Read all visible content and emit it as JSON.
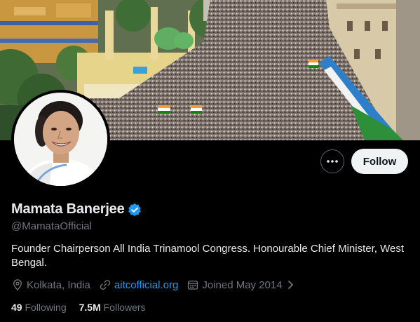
{
  "profile": {
    "display_name": "Mamata Banerjee",
    "handle": "@MamataOfficial",
    "bio": "Founder Chairperson All India Trinamool Congress. Honourable Chief Minister, West Bengal.",
    "verified_color": "#1d9bf0",
    "location": "Kolkata, India",
    "website": "aitcofficial.org",
    "joined": "Joined May 2014",
    "following_count": "49",
    "following_label": "Following",
    "followers_count": "7.5M",
    "followers_label": "Followers"
  },
  "actions": {
    "follow_label": "Follow",
    "more_icon": "more-horizontal-icon"
  },
  "theme": {
    "background": "#000000",
    "text": "#e7e9ea",
    "muted": "#71767b",
    "accent": "#1d9bf0",
    "button_bg": "#eff3f4"
  }
}
